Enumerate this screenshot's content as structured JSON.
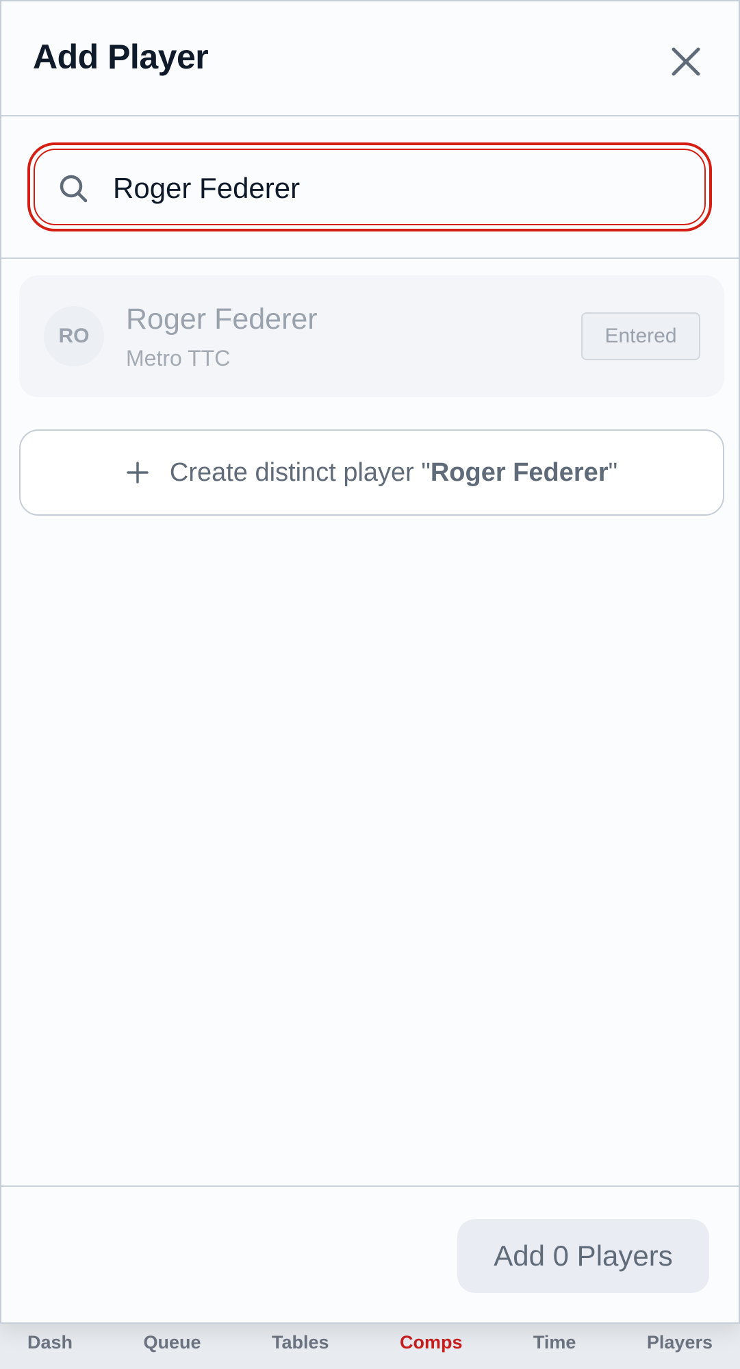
{
  "modal": {
    "title": "Add Player"
  },
  "search": {
    "value": "Roger Federer",
    "placeholder": ""
  },
  "results": [
    {
      "initials": "RO",
      "name": "Roger Federer",
      "club": "Metro TTC",
      "status": "Entered"
    }
  ],
  "create": {
    "prefix": "Create distinct player \"",
    "name": "Roger Federer",
    "suffix": "\""
  },
  "footer": {
    "add_label": "Add 0 Players"
  },
  "nav": {
    "items": [
      "Dash",
      "Queue",
      "Tables",
      "Comps",
      "Time",
      "Players"
    ],
    "active": "Comps"
  },
  "colors": {
    "accent": "#d51e13",
    "nav_active": "#c81e1e"
  },
  "icons": {
    "close": "close-icon",
    "search": "search-icon",
    "plus": "plus-icon"
  }
}
